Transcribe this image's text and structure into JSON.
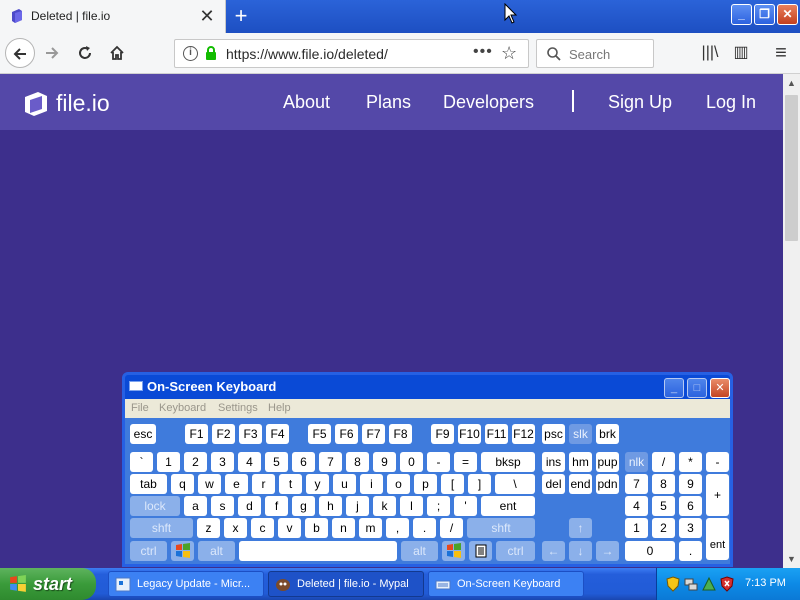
{
  "browser": {
    "tab_title": "Deleted | file.io",
    "tab_close": "✕",
    "new_tab": "+",
    "window_buttons": {
      "minimize": "_",
      "maximize": "❐",
      "close": "✕"
    },
    "url": "https://www.file.io/deleted/",
    "url_menu": "•••",
    "bookmark": "☆",
    "search_placeholder": "Search",
    "library": "|||\\",
    "sidebar": "▥",
    "menu": "≡"
  },
  "site": {
    "logo_text": "file.io",
    "nav": {
      "about": "About",
      "plans": "Plans",
      "developers": "Developers",
      "signup": "Sign Up",
      "login": "Log In"
    }
  },
  "osk": {
    "title": "On-Screen Keyboard",
    "menu": {
      "file": "File",
      "keyboard": "Keyboard",
      "settings": "Settings",
      "help": "Help"
    },
    "keys": {
      "esc": "esc",
      "f1": "F1",
      "f2": "F2",
      "f3": "F3",
      "f4": "F4",
      "f5": "F5",
      "f6": "F6",
      "f7": "F7",
      "f8": "F8",
      "f9": "F9",
      "f10": "F10",
      "f11": "F11",
      "f12": "F12",
      "psc": "psc",
      "slk": "slk",
      "brk": "brk",
      "backtick": "`",
      "n1": "1",
      "n2": "2",
      "n3": "3",
      "n4": "4",
      "n5": "5",
      "n6": "6",
      "n7": "7",
      "n8": "8",
      "n9": "9",
      "n0": "0",
      "minus": "-",
      "equals": "=",
      "bksp": "bksp",
      "ins": "ins",
      "hm": "hm",
      "pup": "pup",
      "nlk": "nlk",
      "slash": "/",
      "star": "*",
      "kminus": "-",
      "tab": "tab",
      "q": "q",
      "w": "w",
      "e": "e",
      "r": "r",
      "t": "t",
      "y": "y",
      "u": "u",
      "i": "i",
      "o": "o",
      "p": "p",
      "lbracket": "[",
      "rbracket": "]",
      "backslash": "\\",
      "del": "del",
      "end": "end",
      "pdn": "pdn",
      "k7": "7",
      "k8": "8",
      "k9": "9",
      "kplus": "+",
      "lock": "lock",
      "a": "a",
      "s": "s",
      "d": "d",
      "f": "f",
      "g": "g",
      "h": "h",
      "j": "j",
      "k": "k",
      "l": "l",
      "semicolon": ";",
      "quote": "'",
      "ent": "ent",
      "k4": "4",
      "k5": "5",
      "k6": "6",
      "lshft": "shft",
      "z": "z",
      "x": "x",
      "c": "c",
      "v": "v",
      "b": "b",
      "n": "n",
      "m": "m",
      "comma": ",",
      "period": ".",
      "fslash": "/",
      "rshft": "shft",
      "up": "↑",
      "k1": "1",
      "k2": "2",
      "k3": "3",
      "kent": "ent",
      "lctrl": "ctrl",
      "lalt": "alt",
      "ralt": "alt",
      "rctrl": "ctrl",
      "left": "←",
      "down": "↓",
      "right": "→",
      "k0": "0",
      "kdot": "."
    }
  },
  "taskbar": {
    "start": "start",
    "tasks": [
      "Legacy Update - Micr...",
      "Deleted | file.io - Mypal",
      "On-Screen Keyboard"
    ],
    "clock": "7:13 PM"
  }
}
